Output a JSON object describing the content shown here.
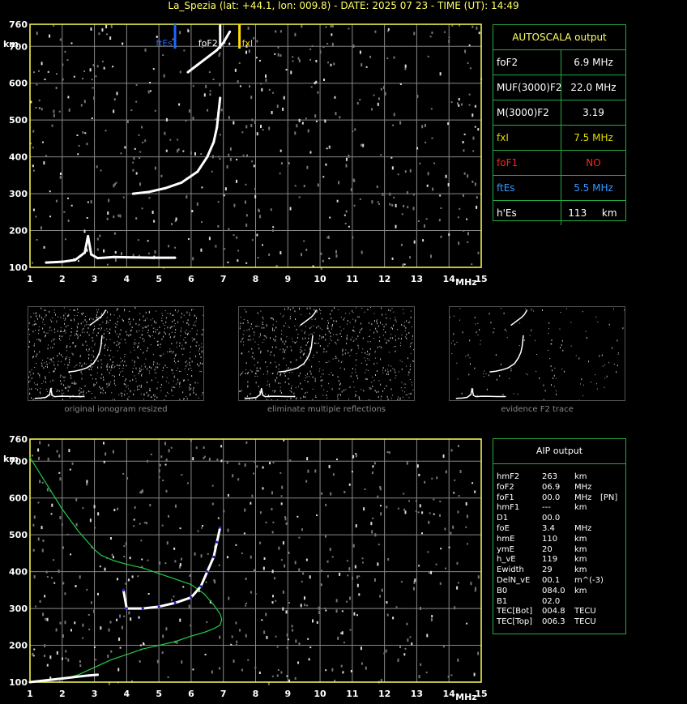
{
  "header": {
    "title": "La_Spezia (lat: +44.1, lon: 009.8) - DATE: 2025 07 23 - TIME (UT): 14:49"
  },
  "colors": {
    "axis": "#ffff55",
    "grid": "#888888",
    "trace": "#ffffff",
    "es": "#2266ff",
    "fxl": "#ffdd00",
    "profile": "#22cc44",
    "fit": "#2222dd"
  },
  "chart_data": [
    {
      "type": "scatter",
      "title": "",
      "xlabel": "MHz",
      "ylabel": "km",
      "xlim": [
        1,
        15
      ],
      "ylim": [
        100,
        760
      ],
      "x_ticks": [
        "1",
        "2",
        "3",
        "4",
        "5",
        "6",
        "7",
        "8",
        "9",
        "10",
        "11",
        "12",
        "13",
        "14",
        "15"
      ],
      "y_ticks": [
        "100",
        "200",
        "300",
        "400",
        "500",
        "600",
        "700",
        "760"
      ],
      "markers": [
        {
          "name": "ftEs",
          "x": 5.5,
          "color": "#2266ff"
        },
        {
          "name": "foF2",
          "x": 6.9,
          "color": "#ffffff"
        },
        {
          "name": "fxl",
          "x": 7.5,
          "color": "#ffdd00"
        }
      ],
      "series": [
        {
          "x": [
            1.5,
            2.0,
            2.4,
            2.7,
            2.8,
            2.9,
            3.1,
            3.6,
            4.2,
            4.8,
            5.5
          ],
          "y": [
            113,
            115,
            120,
            140,
            185,
            135,
            125,
            128,
            127,
            126,
            126
          ]
        },
        {
          "x": [
            4.2,
            4.7,
            5.2,
            5.7,
            6.2,
            6.5,
            6.7,
            6.8,
            6.85,
            6.9
          ],
          "y": [
            300,
            305,
            315,
            330,
            360,
            400,
            440,
            480,
            520,
            560
          ]
        },
        {
          "x": [
            5.9,
            6.2,
            6.5,
            6.8,
            7.0,
            7.2
          ],
          "y": [
            630,
            650,
            670,
            690,
            710,
            740
          ]
        }
      ]
    },
    {
      "type": "scatter",
      "title": "",
      "xlabel": "MHz",
      "ylabel": "km",
      "xlim": [
        1,
        15
      ],
      "ylim": [
        100,
        760
      ],
      "x_ticks": [
        "1",
        "2",
        "3",
        "4",
        "5",
        "6",
        "7",
        "8",
        "9",
        "10",
        "11",
        "12",
        "13",
        "14",
        "15"
      ],
      "y_ticks": [
        "100",
        "200",
        "300",
        "400",
        "500",
        "600",
        "700",
        "760"
      ],
      "series": [
        {
          "x": [
            1.0,
            1.5,
            2.0,
            2.5,
            2.8,
            3.0,
            3.2,
            3.6,
            4.0,
            4.5,
            5.0,
            5.5,
            6.0,
            6.4,
            6.7,
            6.9,
            6.95,
            6.9,
            6.7,
            6.4,
            6.0,
            5.5,
            5.0,
            4.5,
            4.0,
            3.5,
            3.0,
            2.5,
            2.0,
            1.7,
            1.4,
            1.2,
            1.0
          ],
          "y": [
            710,
            640,
            570,
            510,
            480,
            460,
            445,
            430,
            420,
            410,
            395,
            380,
            365,
            340,
            310,
            285,
            270,
            255,
            245,
            235,
            225,
            210,
            200,
            190,
            175,
            160,
            140,
            120,
            108,
            105,
            102,
            101,
            100
          ]
        },
        {
          "x": [
            3.9,
            4.0,
            4.5,
            5.0,
            5.5,
            6.0,
            6.3,
            6.5,
            6.7,
            6.8,
            6.9
          ],
          "y": [
            350,
            300,
            300,
            305,
            315,
            330,
            360,
            400,
            440,
            480,
            520
          ]
        },
        {
          "x": [
            1.0,
            1.5,
            2.0,
            2.5,
            2.8,
            3.1
          ],
          "y": [
            100,
            105,
            110,
            115,
            118,
            120
          ]
        }
      ]
    }
  ],
  "autoscala": {
    "title": "AUTOSCALA output",
    "rows": [
      {
        "k": "foF2",
        "v": "6.9 MHz",
        "kcolor": "#ffffff",
        "vcolor": "#ffffff"
      },
      {
        "k": "MUF(3000)F2",
        "v": "22.0 MHz",
        "kcolor": "#ffffff",
        "vcolor": "#ffffff"
      },
      {
        "k": "M(3000)F2",
        "v": "3.19",
        "kcolor": "#ffffff",
        "vcolor": "#ffffff"
      },
      {
        "k": "fxI",
        "v": "7.5 MHz",
        "kcolor": "#dddd00",
        "vcolor": "#dddd00"
      },
      {
        "k": "foF1",
        "v": "NO",
        "kcolor": "#ff2222",
        "vcolor": "#ff2222"
      },
      {
        "k": "ftEs",
        "v": "5.5 MHz",
        "kcolor": "#3399ff",
        "vcolor": "#3399ff"
      },
      {
        "k": "h'Es",
        "v": "113",
        "unit": "km",
        "kcolor": "#ffffff",
        "vcolor": "#ffffff"
      }
    ]
  },
  "thumbs": {
    "captions": [
      "original ionogram resized",
      "eliminate multiple reflections",
      "evidence F2 trace"
    ]
  },
  "aip": {
    "title": "AIP output",
    "rows": [
      [
        "hmF2",
        "263",
        "km",
        ""
      ],
      [
        "foF2",
        "06.9",
        "MHz",
        ""
      ],
      [
        "foF1",
        "00.0",
        "MHz",
        "[PN]"
      ],
      [
        "hmF1",
        "---",
        "km",
        ""
      ],
      [
        "D1",
        "00.0",
        "",
        ""
      ],
      [
        "foE",
        "3.4",
        "MHz",
        ""
      ],
      [
        "hmE",
        "110",
        "km",
        ""
      ],
      [
        "ymE",
        "20",
        "km",
        ""
      ],
      [
        "h_vE",
        "119",
        "km",
        ""
      ],
      [
        "Ewidth",
        "29",
        "km",
        ""
      ],
      [
        "DelN_vE",
        "00.1",
        "m^(-3)",
        ""
      ],
      [
        "B0",
        "084.0",
        "km",
        ""
      ],
      [
        "B1",
        "02.0",
        "",
        ""
      ],
      [
        "TEC[Bot]",
        "004.8",
        "TECU",
        ""
      ],
      [
        "TEC[Top]",
        "006.3",
        "TECU",
        ""
      ]
    ]
  }
}
